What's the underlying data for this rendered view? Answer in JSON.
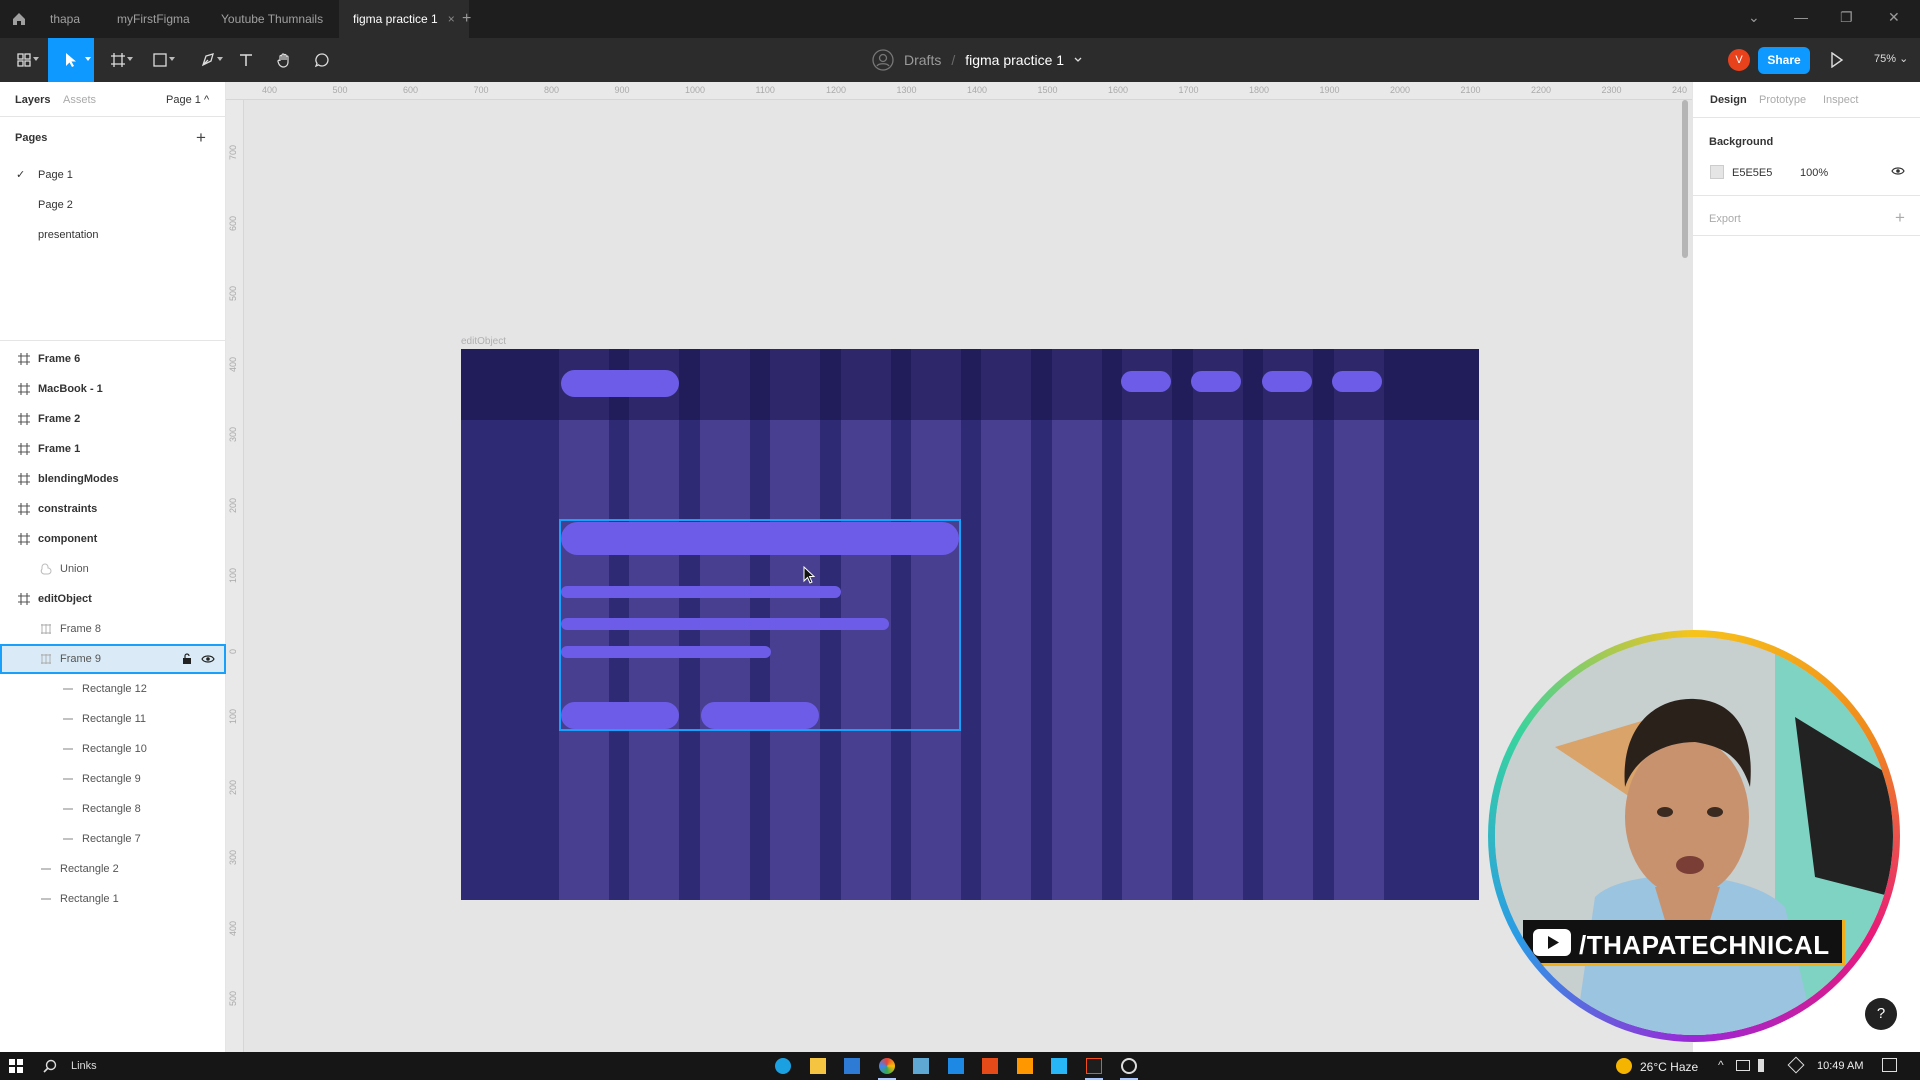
{
  "title_bar": {
    "tabs": [
      {
        "label": "thapa",
        "active": false
      },
      {
        "label": "myFirstFigma",
        "active": false
      },
      {
        "label": "Youtube Thumnails",
        "active": false
      },
      {
        "label": "figma practice 1",
        "active": true
      }
    ],
    "close_glyph": "×",
    "add_tab_glyph": "+",
    "window_controls": [
      "⌄",
      "—",
      "❐",
      "✕"
    ]
  },
  "toolbar": {
    "tools": [
      "main-menu-icon",
      "move-icon",
      "frame-icon",
      "rectangle-icon",
      "pen-icon",
      "text-icon",
      "hand-icon",
      "comment-icon"
    ],
    "location": "Drafts",
    "separator": "/",
    "file_name": "figma practice 1",
    "user_initial": "V",
    "share_label": "Share",
    "zoom": "75%"
  },
  "left_panel": {
    "tabs": [
      "Layers",
      "Assets"
    ],
    "page_selector": "Page 1",
    "pages_title": "Pages",
    "pages": [
      {
        "label": "Page 1",
        "current": true
      },
      {
        "label": "Page 2",
        "current": false
      },
      {
        "label": "presentation",
        "current": false
      }
    ],
    "layers": [
      {
        "label": "Frame 6",
        "type": "frame",
        "depth": 0,
        "bold": true
      },
      {
        "label": "MacBook - 1",
        "type": "frame",
        "depth": 0,
        "bold": true
      },
      {
        "label": "Frame 2",
        "type": "frame",
        "depth": 0,
        "bold": true
      },
      {
        "label": "Frame 1",
        "type": "frame",
        "depth": 0,
        "bold": true
      },
      {
        "label": "blendingModes",
        "type": "frame",
        "depth": 0,
        "bold": true
      },
      {
        "label": "constraints",
        "type": "frame",
        "depth": 0,
        "bold": true
      },
      {
        "label": "component",
        "type": "frame",
        "depth": 0,
        "bold": true
      },
      {
        "label": "Union",
        "type": "union",
        "depth": 1,
        "bold": false
      },
      {
        "label": "editObject",
        "type": "frame",
        "depth": 0,
        "bold": true
      },
      {
        "label": "Frame 8",
        "type": "grid",
        "depth": 1,
        "bold": false
      },
      {
        "label": "Frame 9",
        "type": "grid",
        "depth": 1,
        "bold": false,
        "selected": true
      },
      {
        "label": "Rectangle 12",
        "type": "rect",
        "depth": 2,
        "bold": false
      },
      {
        "label": "Rectangle 11",
        "type": "rect",
        "depth": 2,
        "bold": false
      },
      {
        "label": "Rectangle 10",
        "type": "rect",
        "depth": 2,
        "bold": false
      },
      {
        "label": "Rectangle 9",
        "type": "rect",
        "depth": 2,
        "bold": false
      },
      {
        "label": "Rectangle 8",
        "type": "rect",
        "depth": 2,
        "bold": false
      },
      {
        "label": "Rectangle 7",
        "type": "rect",
        "depth": 2,
        "bold": false
      },
      {
        "label": "Rectangle 2",
        "type": "rect",
        "depth": 1,
        "bold": false
      },
      {
        "label": "Rectangle 1",
        "type": "rect",
        "depth": 1,
        "bold": false
      }
    ]
  },
  "canvas": {
    "ruler_top": [
      "400",
      "500",
      "600",
      "700",
      "800",
      "900",
      "1000",
      "1100",
      "1200",
      "1300",
      "1400",
      "1500",
      "1600",
      "1700",
      "1800",
      "1900",
      "2000",
      "2100",
      "2200",
      "2300",
      "240"
    ],
    "ruler_left": [
      "700",
      "600",
      "500",
      "400",
      "300",
      "200",
      "100",
      "0",
      "100",
      "200",
      "300",
      "400",
      "500"
    ],
    "frame_label": "editObject",
    "frame_color": "#2e2a74",
    "pill_color": "#6c5ce7",
    "selection_color": "#18a0fb"
  },
  "right_panel": {
    "tabs": [
      "Design",
      "Prototype",
      "Inspect"
    ],
    "background_title": "Background",
    "background_hex": "E5E5E5",
    "background_opacity": "100%",
    "export_label": "Export",
    "add_glyph": "+"
  },
  "overlay": {
    "channel_name": "/THAPATECHNICAL",
    "help_glyph": "?"
  },
  "taskbar": {
    "search_label": "Links",
    "weather": "26°C Haze",
    "time": "10:49 AM"
  }
}
